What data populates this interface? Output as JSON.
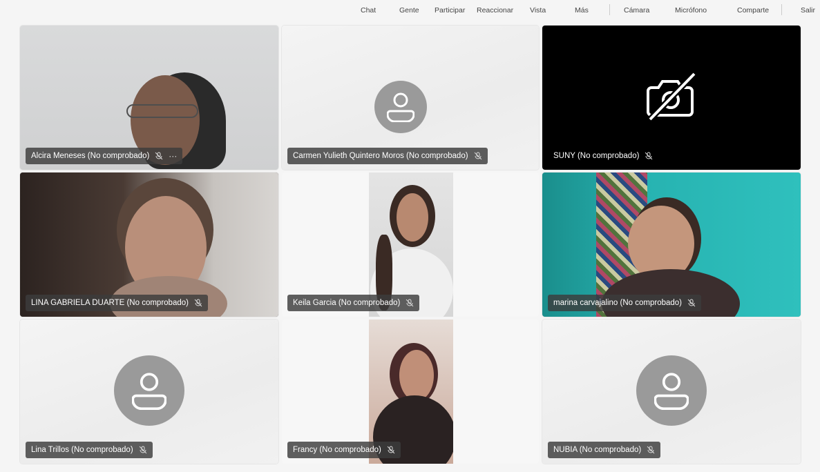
{
  "toolbar": {
    "chat": "Chat",
    "people": "Gente",
    "participate": "Participar",
    "react": "Reaccionar",
    "view": "Vista",
    "more": "Más",
    "camera": "Cámara",
    "microphone": "Micrófono",
    "share": "Comparte",
    "leave": "Salir"
  },
  "participants": [
    {
      "name": "Alcira Meneses (No comprobado)",
      "video": true,
      "more": "···"
    },
    {
      "name": "Carmen Yulieth Quintero Moros (No comprobado)",
      "video": false
    },
    {
      "name": "SUNY (No comprobado)",
      "video": false,
      "camera_off": true
    },
    {
      "name": "LINA GABRIELA DUARTE (No comprobado)",
      "video": true
    },
    {
      "name": "Keila Garcia (No comprobado)",
      "video": true
    },
    {
      "name": "marina carvajalino (No comprobado)",
      "video": true
    },
    {
      "name": "Lina Trillos (No comprobado)",
      "video": false
    },
    {
      "name": "Francy (No comprobado)",
      "video": true
    },
    {
      "name": "NUBIA (No comprobado)",
      "video": false
    }
  ],
  "colors": {
    "avatar": "#9a9a9a",
    "label_bg": "#3c3c3c",
    "camera_off_bg": "#000000"
  }
}
